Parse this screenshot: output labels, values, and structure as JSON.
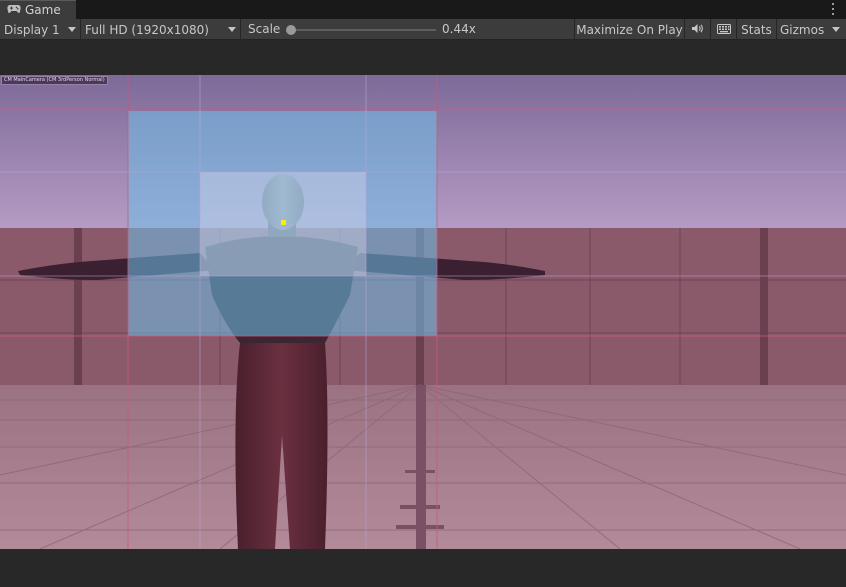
{
  "tab": {
    "title": "Game",
    "icon": "gamepad-icon"
  },
  "toolbar": {
    "display": "Display 1",
    "resolution": "Full HD (1920x1080)",
    "scale_label": "Scale",
    "scale_value": "0.44x",
    "maximize": "Maximize On Play",
    "stats": "Stats",
    "gizmos": "Gizmos"
  },
  "viewport": {
    "camera_label": "CM MainCamera (CM 3rdPerson Normal)"
  },
  "colors": {
    "sky": "#8e7aa8",
    "wall": "#8c5a6c",
    "floor": "#a77f8f",
    "dead_zone": "#6cb8e4",
    "soft_zone": "#d9cee8",
    "guide_line": "#c85a78",
    "target_dot": "#ffee00"
  }
}
